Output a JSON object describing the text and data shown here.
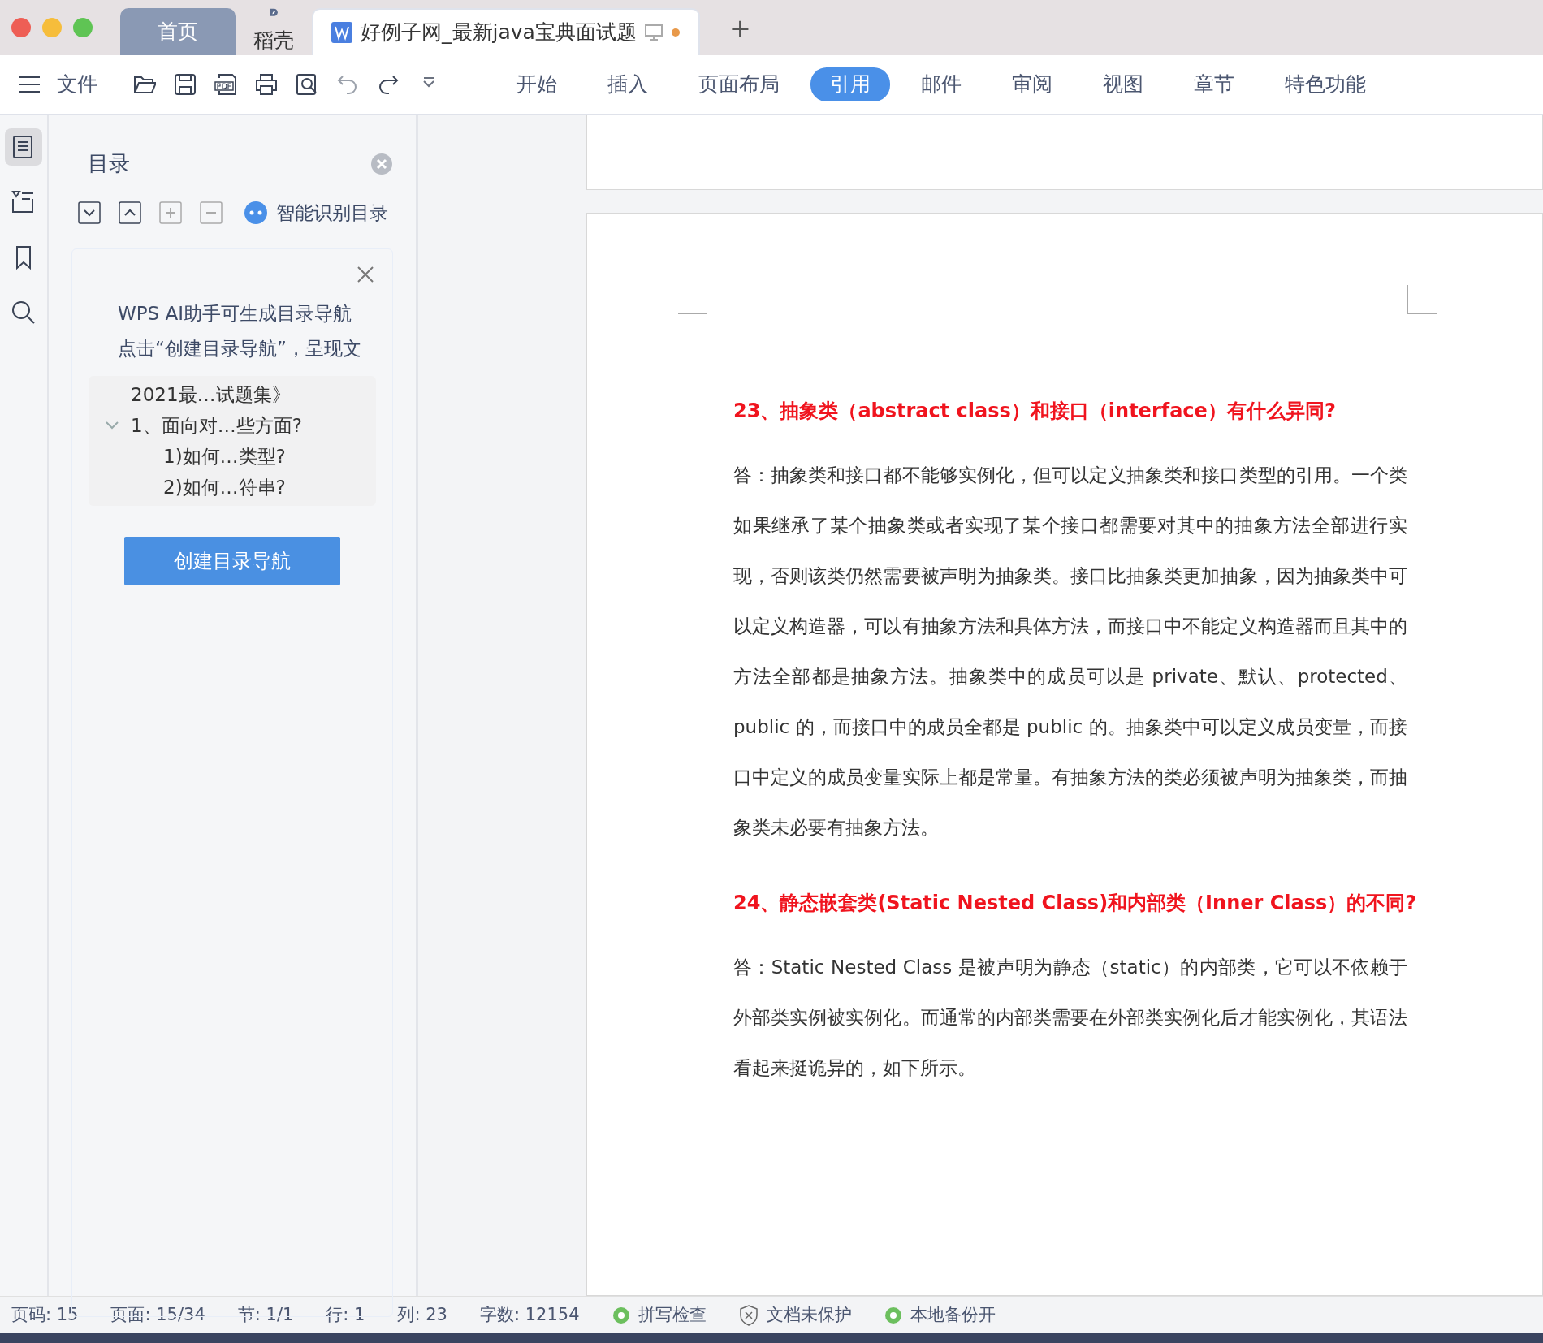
{
  "tabs": [
    {
      "label": "首页",
      "kind": "home",
      "selected": false
    },
    {
      "label": "稻壳",
      "kind": "app",
      "selected": false
    },
    {
      "label": "好例子网_最新java宝典面试题",
      "kind": "doc",
      "selected": true
    }
  ],
  "new_tab": {
    "label": "+"
  },
  "menu": {
    "label": "文件"
  },
  "ribbon_tabs": [
    {
      "label": "开始",
      "selected": false
    },
    {
      "label": "插入",
      "selected": false
    },
    {
      "label": "页面布局",
      "selected": false
    },
    {
      "label": "引用",
      "selected": true
    },
    {
      "label": "邮件",
      "selected": false
    },
    {
      "label": "审阅",
      "selected": false
    },
    {
      "label": "视图",
      "selected": false
    },
    {
      "label": "章节",
      "selected": false
    },
    {
      "label": "特色功能",
      "selected": false
    }
  ],
  "rail": [
    {
      "kind": "toc",
      "selected": true
    },
    {
      "kind": "nav",
      "selected": false
    },
    {
      "kind": "bookmark",
      "selected": false
    },
    {
      "kind": "search",
      "selected": false
    }
  ],
  "panel": {
    "title": "目录",
    "smart_button": "智能识别目录",
    "ai_tip": {
      "lines": [
        "WPS AI助手可生成目录导航",
        "点击“创建目录导航”，呈现文"
      ],
      "outline": [
        {
          "text": "2021最…试题集》"
        },
        {
          "text": "1、面向对…些方面?",
          "expanded": true,
          "children": [
            {
              "text": "1)如何…类型?"
            },
            {
              "text": "2)如何…符串?"
            }
          ]
        }
      ],
      "button": "创建目录导航"
    }
  },
  "document": [
    {
      "kind": "heading",
      "text": "23、抽象类（abstract  class）和接口（interface）有什么异同?"
    },
    {
      "kind": "paragraph",
      "text": "答：抽象类和接口都不能够实例化，但可以定义抽象类和接口类型的引用。一个类如果继承了某个抽象类或者实现了某个接口都需要对其中的抽象方法全部进行实现，否则该类仍然需要被声明为抽象类。接口比抽象类更加抽象，因为抽象类中可以定义构造器，可以有抽象方法和具体方法，而接口中不能定义构造器而且其中的方法全部都是抽象方法。抽象类中的成员可以是 private、默认、protected、public 的，而接口中的成员全都是 public 的。抽象类中可以定义成员变量，而接口中定义的成员变量实际上都是常量。有抽象方法的类必须被声明为抽象类，而抽象类未必要有抽象方法。"
    },
    {
      "kind": "heading",
      "text": "24、静态嵌套类(Static  Nested  Class)和内部类（Inner  Class）的不同?"
    },
    {
      "kind": "paragraph",
      "text": "答：Static  Nested  Class 是被声明为静态（static）的内部类，它可以不依赖于外部类实例被实例化。而通常的内部类需要在外部类实例化后才能实例化，其语法看起来挺诡异的，如下所示。"
    }
  ],
  "status_bar": [
    {
      "kind": "text",
      "text": "页码: 15"
    },
    {
      "kind": "text",
      "text": "页面: 15/34"
    },
    {
      "kind": "text",
      "text": "节: 1/1"
    },
    {
      "kind": "text",
      "text": "行: 1"
    },
    {
      "kind": "text",
      "text": "列: 23"
    },
    {
      "kind": "text",
      "text": "字数: 12154"
    },
    {
      "kind": "toggle",
      "text": "拼写检查"
    },
    {
      "kind": "shield",
      "text": "文档未保护"
    },
    {
      "kind": "toggle",
      "text": "本地备份开"
    }
  ]
}
